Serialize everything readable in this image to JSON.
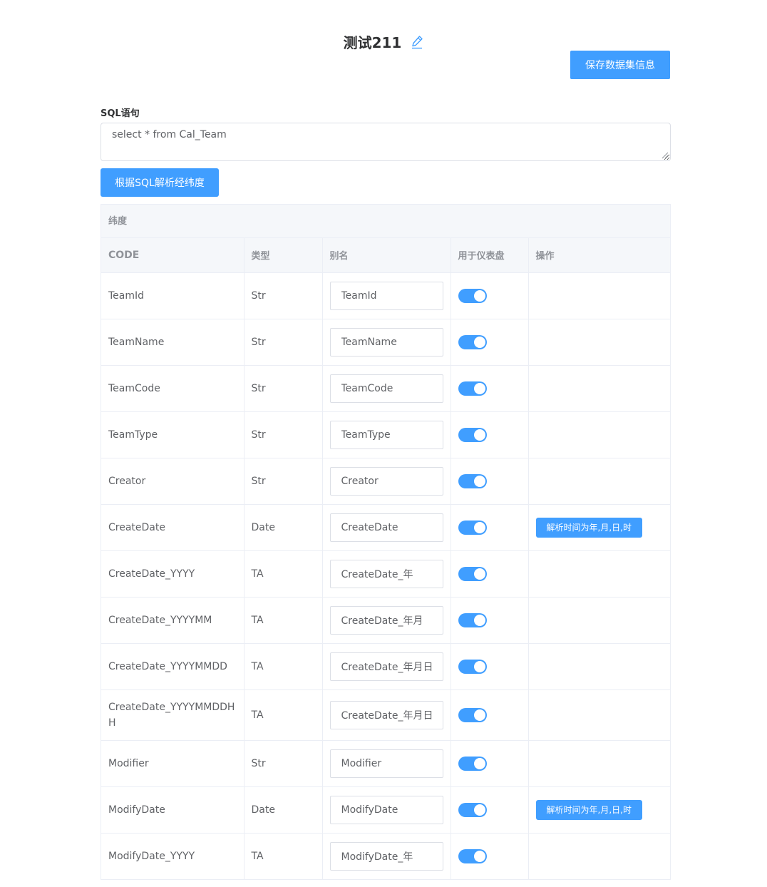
{
  "header": {
    "title": "测试211",
    "edit_icon": "pencil-icon",
    "save_label": "保存数据集信息"
  },
  "sql": {
    "label": "SQL语句",
    "value": "select * from Cal_Team"
  },
  "parse_button_label": "根据SQL解析经纬度",
  "table": {
    "group_label": "纬度",
    "columns": [
      "CODE",
      "类型",
      "别名",
      "用于仪表盘",
      "操作"
    ],
    "rows": [
      {
        "code": "TeamId",
        "type": "Str",
        "alias": "TeamId",
        "dashboard": true,
        "action": ""
      },
      {
        "code": "TeamName",
        "type": "Str",
        "alias": "TeamName",
        "dashboard": true,
        "action": ""
      },
      {
        "code": "TeamCode",
        "type": "Str",
        "alias": "TeamCode",
        "dashboard": true,
        "action": ""
      },
      {
        "code": "TeamType",
        "type": "Str",
        "alias": "TeamType",
        "dashboard": true,
        "action": ""
      },
      {
        "code": "Creator",
        "type": "Str",
        "alias": "Creator",
        "dashboard": true,
        "action": ""
      },
      {
        "code": "CreateDate",
        "type": "Date",
        "alias": "CreateDate",
        "dashboard": true,
        "action": "解析时间为年,月,日,时"
      },
      {
        "code": "CreateDate_YYYY",
        "type": "TA",
        "alias": "CreateDate_年",
        "dashboard": true,
        "action": ""
      },
      {
        "code": "CreateDate_YYYYMM",
        "type": "TA",
        "alias": "CreateDate_年月",
        "dashboard": true,
        "action": ""
      },
      {
        "code": "CreateDate_YYYYMMDD",
        "type": "TA",
        "alias": "CreateDate_年月日",
        "dashboard": true,
        "action": ""
      },
      {
        "code": "CreateDate_YYYYMMDDHH",
        "type": "TA",
        "alias": "CreateDate_年月日时",
        "dashboard": true,
        "action": ""
      },
      {
        "code": "Modifier",
        "type": "Str",
        "alias": "Modifier",
        "dashboard": true,
        "action": ""
      },
      {
        "code": "ModifyDate",
        "type": "Date",
        "alias": "ModifyDate",
        "dashboard": true,
        "action": "解析时间为年,月,日,时"
      },
      {
        "code": "ModifyDate_YYYY",
        "type": "TA",
        "alias": "ModifyDate_年",
        "dashboard": true,
        "action": ""
      }
    ]
  },
  "colors": {
    "primary": "#409eff",
    "header_bg": "#f5f7fa",
    "border": "#ebeef5"
  }
}
